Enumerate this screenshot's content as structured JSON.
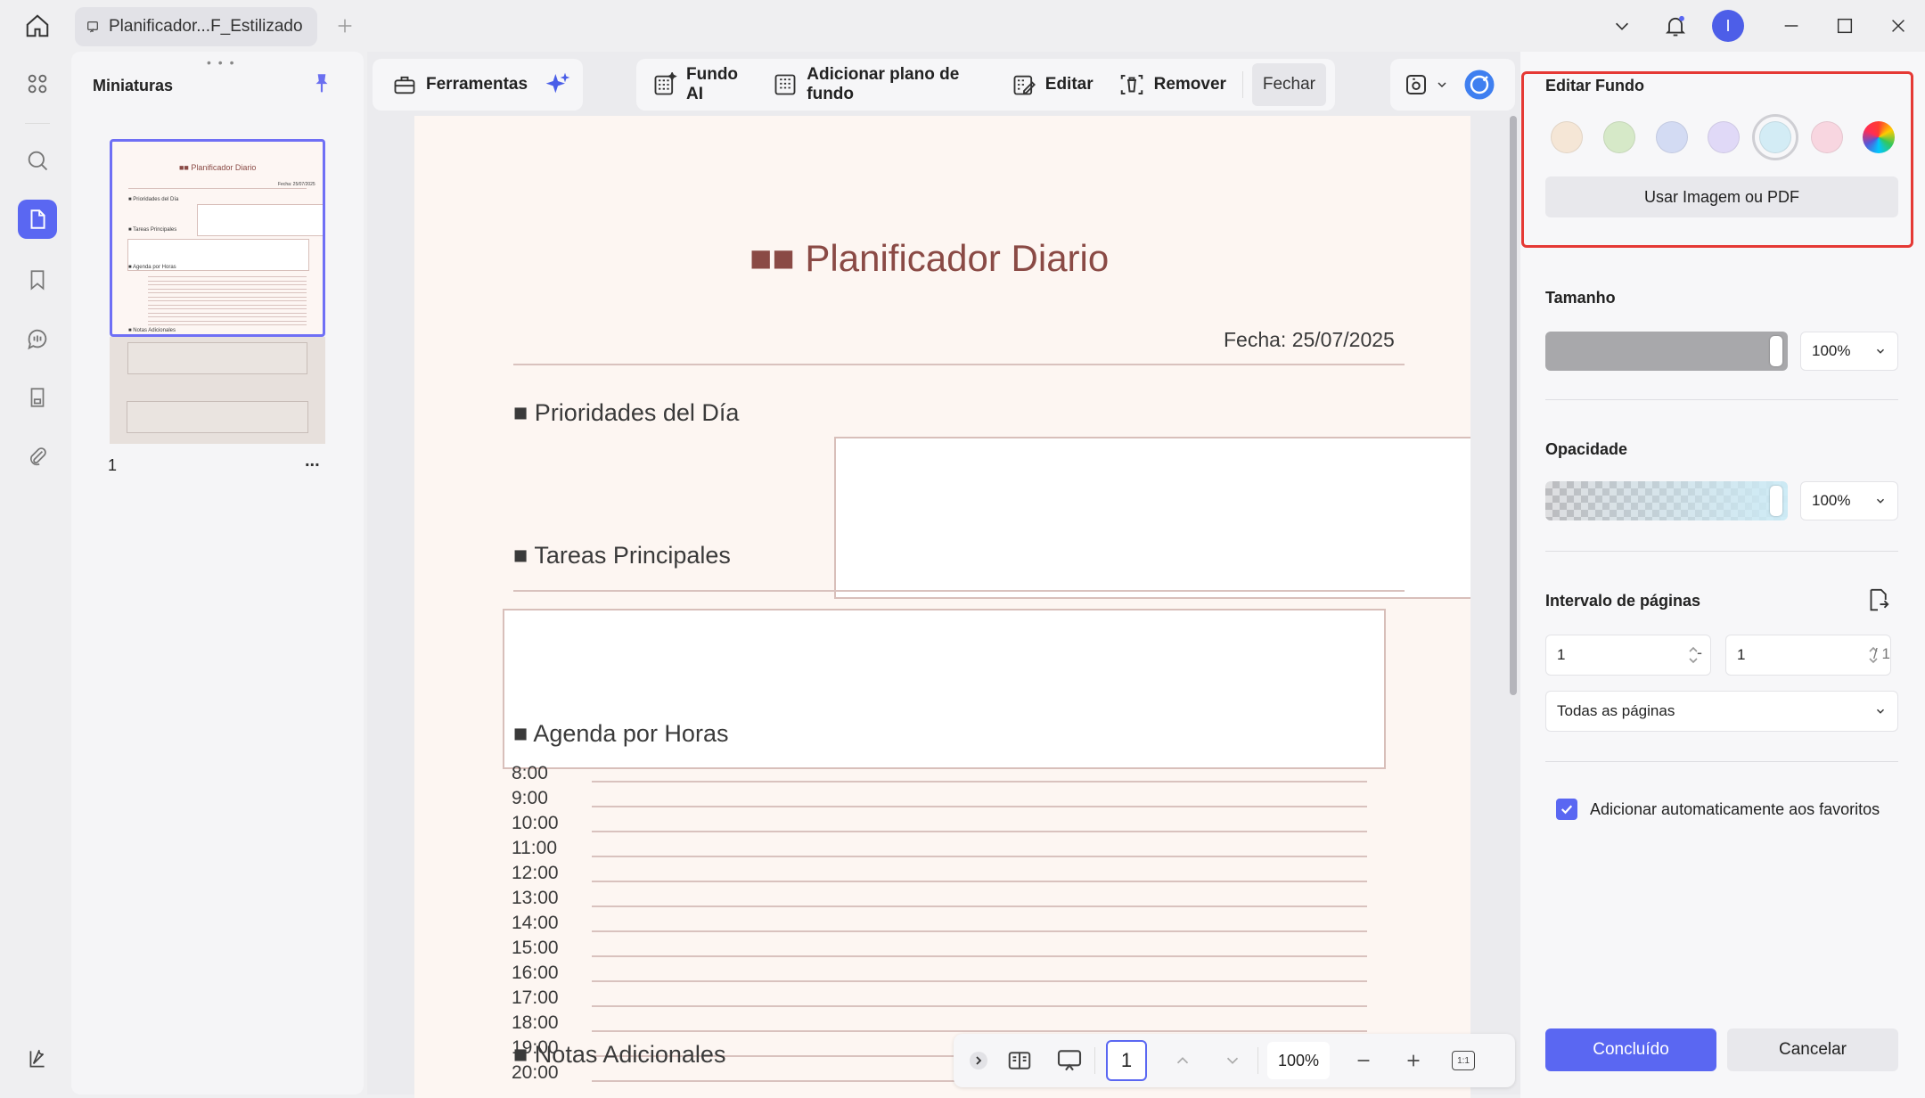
{
  "tab": {
    "title": "Planificador...F_Estilizado"
  },
  "left_panel": {
    "title": "Miniaturas",
    "page_number": "1",
    "more": "..."
  },
  "toolbar": {
    "tools": "Ferramentas",
    "fundo_ai": "Fundo AI",
    "add_background": "Adicionar plano de fundo",
    "edit": "Editar",
    "remove": "Remover",
    "close": "Fechar"
  },
  "document": {
    "title": "■■ Planificador Diario",
    "date": "Fecha: 25/07/2025",
    "section1": "■ Prioridades del Día",
    "section2": "■ Tareas Principales",
    "section3": "■ Agenda por Horas",
    "section4": "■ Notas Adicionales",
    "hours": [
      "8:00",
      "9:00",
      "10:00",
      "11:00",
      "12:00",
      "13:00",
      "14:00",
      "15:00",
      "16:00",
      "17:00",
      "18:00",
      "19:00",
      "20:00"
    ]
  },
  "thumbnail": {
    "title": "■■ Planificador Diario",
    "date": "Fecha: 25/07/2025",
    "s1": "■ Prioridades del Día",
    "s2": "■ Tareas Principales",
    "s3": "■ Agenda por Horas",
    "s4": "■ Notas Adicionales"
  },
  "bottom_bar": {
    "page_value": "1",
    "zoom": "100%",
    "fit_label": "1:1"
  },
  "panel": {
    "edit_bg_title": "Editar Fundo",
    "use_image": "Usar Imagem ou PDF",
    "size_title": "Tamanho",
    "size_value": "100%",
    "opacity_title": "Opacidade",
    "opacity_value": "100%",
    "range_title": "Intervalo de páginas",
    "range_from": "1",
    "range_sep": "-",
    "range_to": "1",
    "range_total": "/ 1",
    "pages_option": "Todas as páginas",
    "auto_fav": "Adicionar automaticamente aos favoritos",
    "done": "Concluído",
    "cancel": "Cancelar"
  },
  "colors": {
    "accent": "#5a67f2",
    "highlight_red": "#e53935",
    "swatches": [
      "#f5e6d6",
      "#d6e9c8",
      "#d3dbf3",
      "#e0d9f7",
      "#d3ecf5",
      "#f8d6e0"
    ]
  },
  "user": {
    "initial": "I"
  }
}
